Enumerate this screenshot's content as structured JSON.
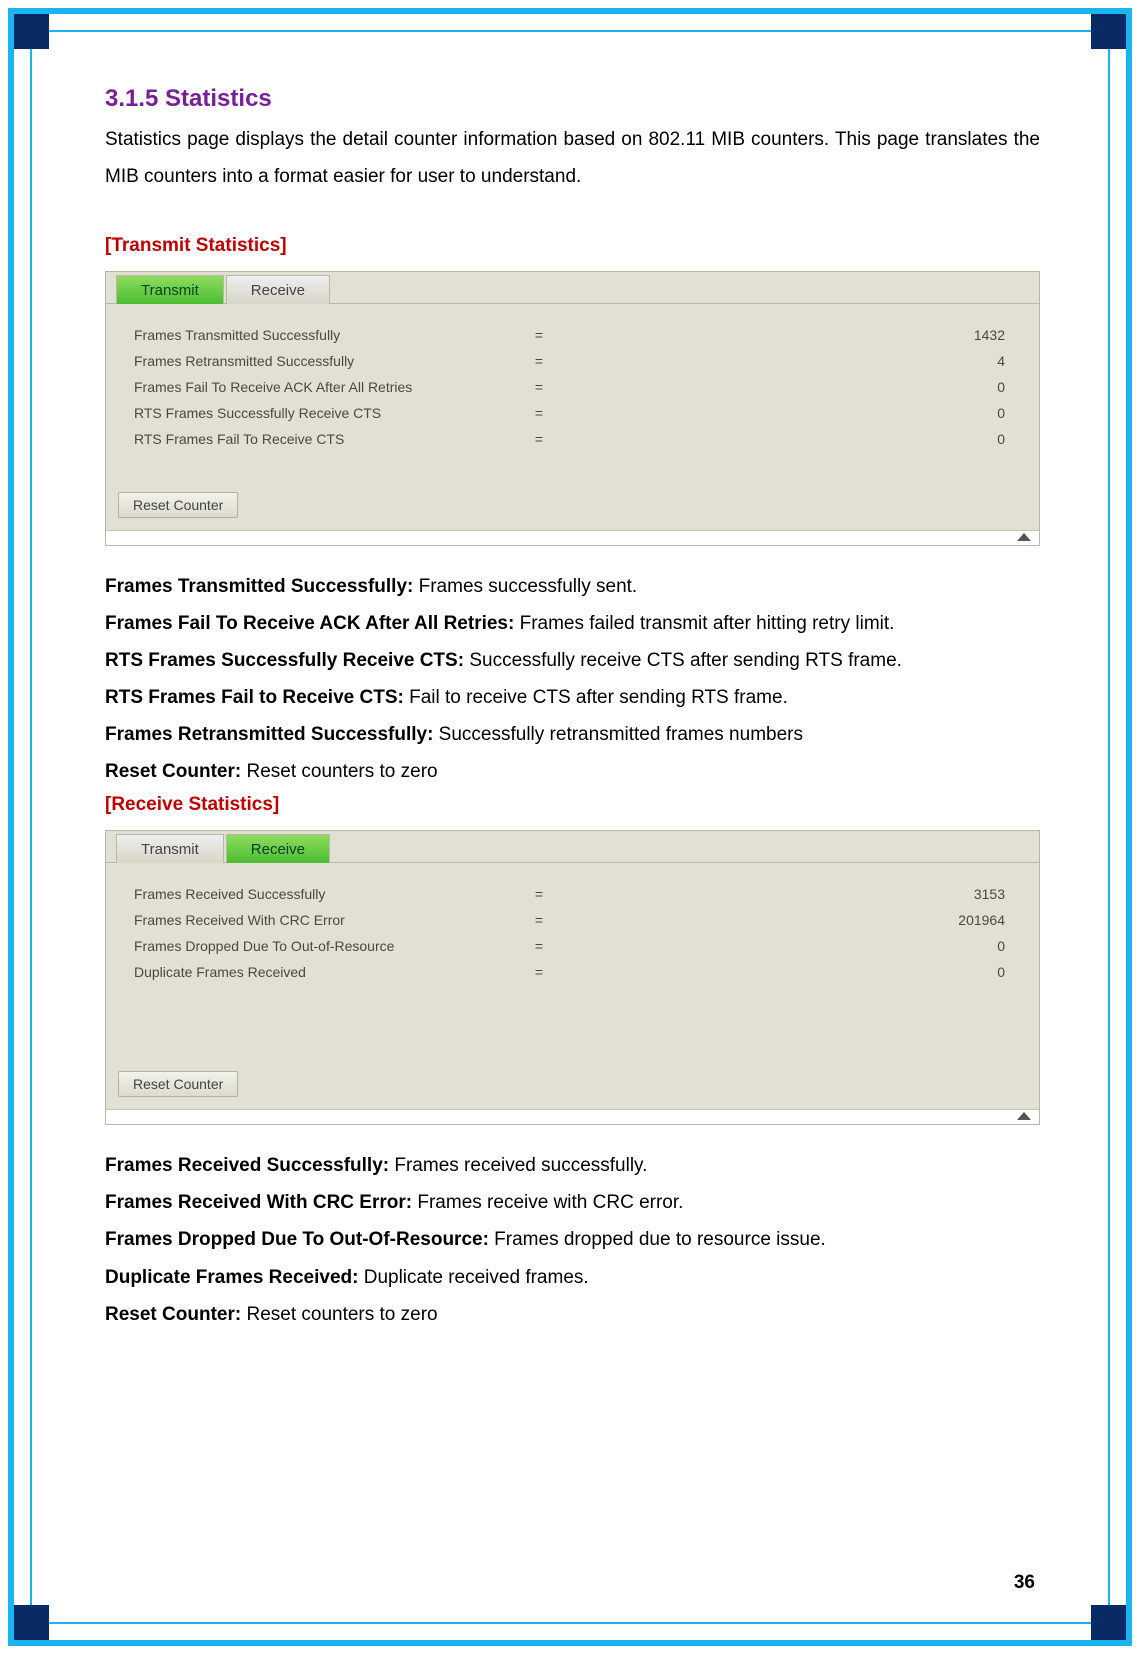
{
  "page_number": "36",
  "heading": "3.1.5   Statistics",
  "intro": "Statistics page displays the detail counter information based on 802.11 MIB counters. This page translates the MIB counters into a format easier for user to understand.",
  "transmit": {
    "section_label": "[Transmit Statistics]",
    "tabs": {
      "transmit": "Transmit",
      "receive": "Receive"
    },
    "rows": [
      {
        "label": "Frames Transmitted Successfully",
        "value": "1432"
      },
      {
        "label": "Frames Retransmitted Successfully",
        "value": "4"
      },
      {
        "label": "Frames Fail To Receive ACK After All Retries",
        "value": "0"
      },
      {
        "label": "RTS Frames Successfully Receive CTS",
        "value": "0"
      },
      {
        "label": "RTS Frames Fail To Receive CTS",
        "value": "0"
      }
    ],
    "reset_label": "Reset Counter",
    "descs": [
      {
        "k": "Frames Transmitted Successfully:",
        "v": " Frames successfully sent."
      },
      {
        "k": "Frames Fail To Receive ACK After All Retries:",
        "v": " Frames failed transmit after hitting retry limit."
      },
      {
        "k": "RTS Frames Successfully Receive CTS:",
        "v": " Successfully receive CTS after sending RTS frame."
      },
      {
        "k": "RTS Frames Fail to Receive CTS:",
        "v": " Fail to receive CTS after sending RTS frame."
      },
      {
        "k": "Frames Retransmitted Successfully:",
        "v": " Successfully retransmitted frames numbers"
      },
      {
        "k": "Reset Counter:",
        "v": " Reset counters to zero"
      }
    ]
  },
  "receive": {
    "section_label": "[Receive Statistics]",
    "tabs": {
      "transmit": "Transmit",
      "receive": "Receive"
    },
    "rows": [
      {
        "label": "Frames Received Successfully",
        "value": "3153"
      },
      {
        "label": "Frames Received With CRC Error",
        "value": "201964"
      },
      {
        "label": "Frames Dropped Due To Out-of-Resource",
        "value": "0"
      },
      {
        "label": "Duplicate Frames Received",
        "value": "0"
      }
    ],
    "reset_label": "Reset Counter",
    "descs": [
      {
        "k": "Frames Received Successfully:",
        "v": " Frames received successfully."
      },
      {
        "k": "Frames Received With CRC Error:",
        "v": " Frames receive with CRC error."
      },
      {
        "k": "Frames Dropped Due To Out-Of-Resource:",
        "v": " Frames dropped due to resource issue."
      },
      {
        "k": "Duplicate Frames Received:",
        "v": " Duplicate received frames."
      },
      {
        "k": "Reset Counter:",
        "v": " Reset counters to zero"
      }
    ]
  },
  "eq": "="
}
